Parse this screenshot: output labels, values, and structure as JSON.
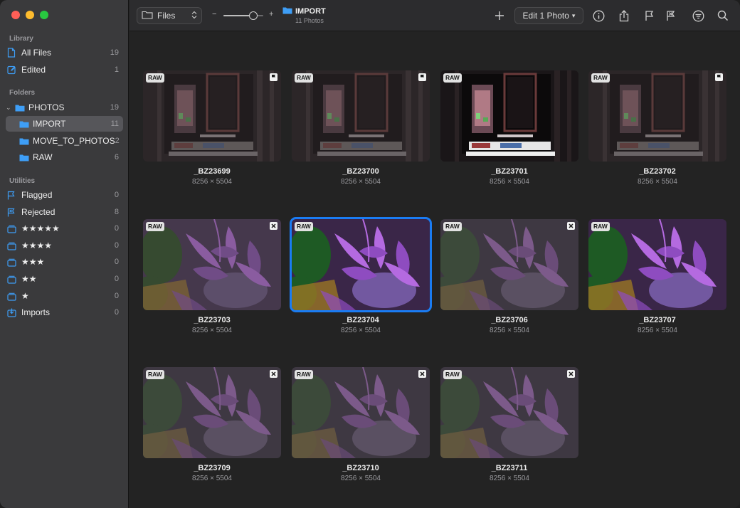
{
  "sidebar": {
    "library_title": "Library",
    "library": [
      {
        "label": "All Files",
        "count": "19",
        "icon": "doc-icon"
      },
      {
        "label": "Edited",
        "count": "1",
        "icon": "edit-icon"
      }
    ],
    "folders_title": "Folders",
    "folders": [
      {
        "label": "PHOTOS",
        "count": "19",
        "expanded": true
      },
      {
        "label": "IMPORT",
        "count": "11",
        "selected": true
      },
      {
        "label": "MOVE_TO_PHOTOS",
        "count": "2"
      },
      {
        "label": "RAW",
        "count": "6"
      }
    ],
    "utilities_title": "Utilities",
    "utilities": [
      {
        "label": "Flagged",
        "count": "0",
        "icon": "flag-icon"
      },
      {
        "label": "Rejected",
        "count": "8",
        "icon": "reject-flag-icon"
      },
      {
        "label": "★★★★★",
        "count": "0",
        "icon": "stack-icon"
      },
      {
        "label": "★★★★",
        "count": "0",
        "icon": "stack-icon"
      },
      {
        "label": "★★★",
        "count": "0",
        "icon": "stack-icon"
      },
      {
        "label": "★★",
        "count": "0",
        "icon": "stack-icon"
      },
      {
        "label": "★",
        "count": "0",
        "icon": "stack-icon"
      },
      {
        "label": "Imports",
        "count": "0",
        "icon": "import-icon"
      }
    ]
  },
  "toolbar": {
    "files_label": "Files",
    "zoom_minus": "−",
    "zoom_plus": "+",
    "zoom_level": 0.75,
    "title": "IMPORT",
    "subtitle": "11 Photos",
    "edit_label": "Edit 1 Photo"
  },
  "photos": [
    {
      "name": "_BZ23699",
      "dims": "8256 × 5504",
      "badge": "RAW",
      "flag": "flag",
      "scene": "door",
      "tone": "dark"
    },
    {
      "name": "_BZ23700",
      "dims": "8256 × 5504",
      "badge": "RAW",
      "flag": "flag",
      "scene": "door",
      "tone": "dark"
    },
    {
      "name": "_BZ23701",
      "dims": "8256 × 5504",
      "badge": "RAW",
      "flag": "none",
      "scene": "door",
      "tone": "bright"
    },
    {
      "name": "_BZ23702",
      "dims": "8256 × 5504",
      "badge": "RAW",
      "flag": "flag",
      "scene": "door",
      "tone": "dark"
    },
    {
      "name": "_BZ23703",
      "dims": "8256 × 5504",
      "badge": "RAW",
      "flag": "reject",
      "scene": "flower",
      "tone": "mid"
    },
    {
      "name": "_BZ23704",
      "dims": "8256 × 5504",
      "badge": "RAW",
      "flag": "none",
      "scene": "flower",
      "tone": "bright",
      "selected": true
    },
    {
      "name": "_BZ23706",
      "dims": "8256 × 5504",
      "badge": "RAW",
      "flag": "reject",
      "scene": "flower",
      "tone": "dark"
    },
    {
      "name": "_BZ23707",
      "dims": "8256 × 5504",
      "badge": "RAW",
      "flag": "none",
      "scene": "flower",
      "tone": "bright"
    },
    {
      "name": "_BZ23709",
      "dims": "8256 × 5504",
      "badge": "RAW",
      "flag": "reject",
      "scene": "flower",
      "tone": "dark"
    },
    {
      "name": "_BZ23710",
      "dims": "8256 × 5504",
      "badge": "RAW",
      "flag": "reject",
      "scene": "flower",
      "tone": "dark"
    },
    {
      "name": "_BZ23711",
      "dims": "8256 × 5504",
      "badge": "RAW",
      "flag": "reject",
      "scene": "flower",
      "tone": "dark"
    }
  ],
  "colors": {
    "accent": "#1a7cf3",
    "sidebar_icon": "#3e9ef6"
  }
}
